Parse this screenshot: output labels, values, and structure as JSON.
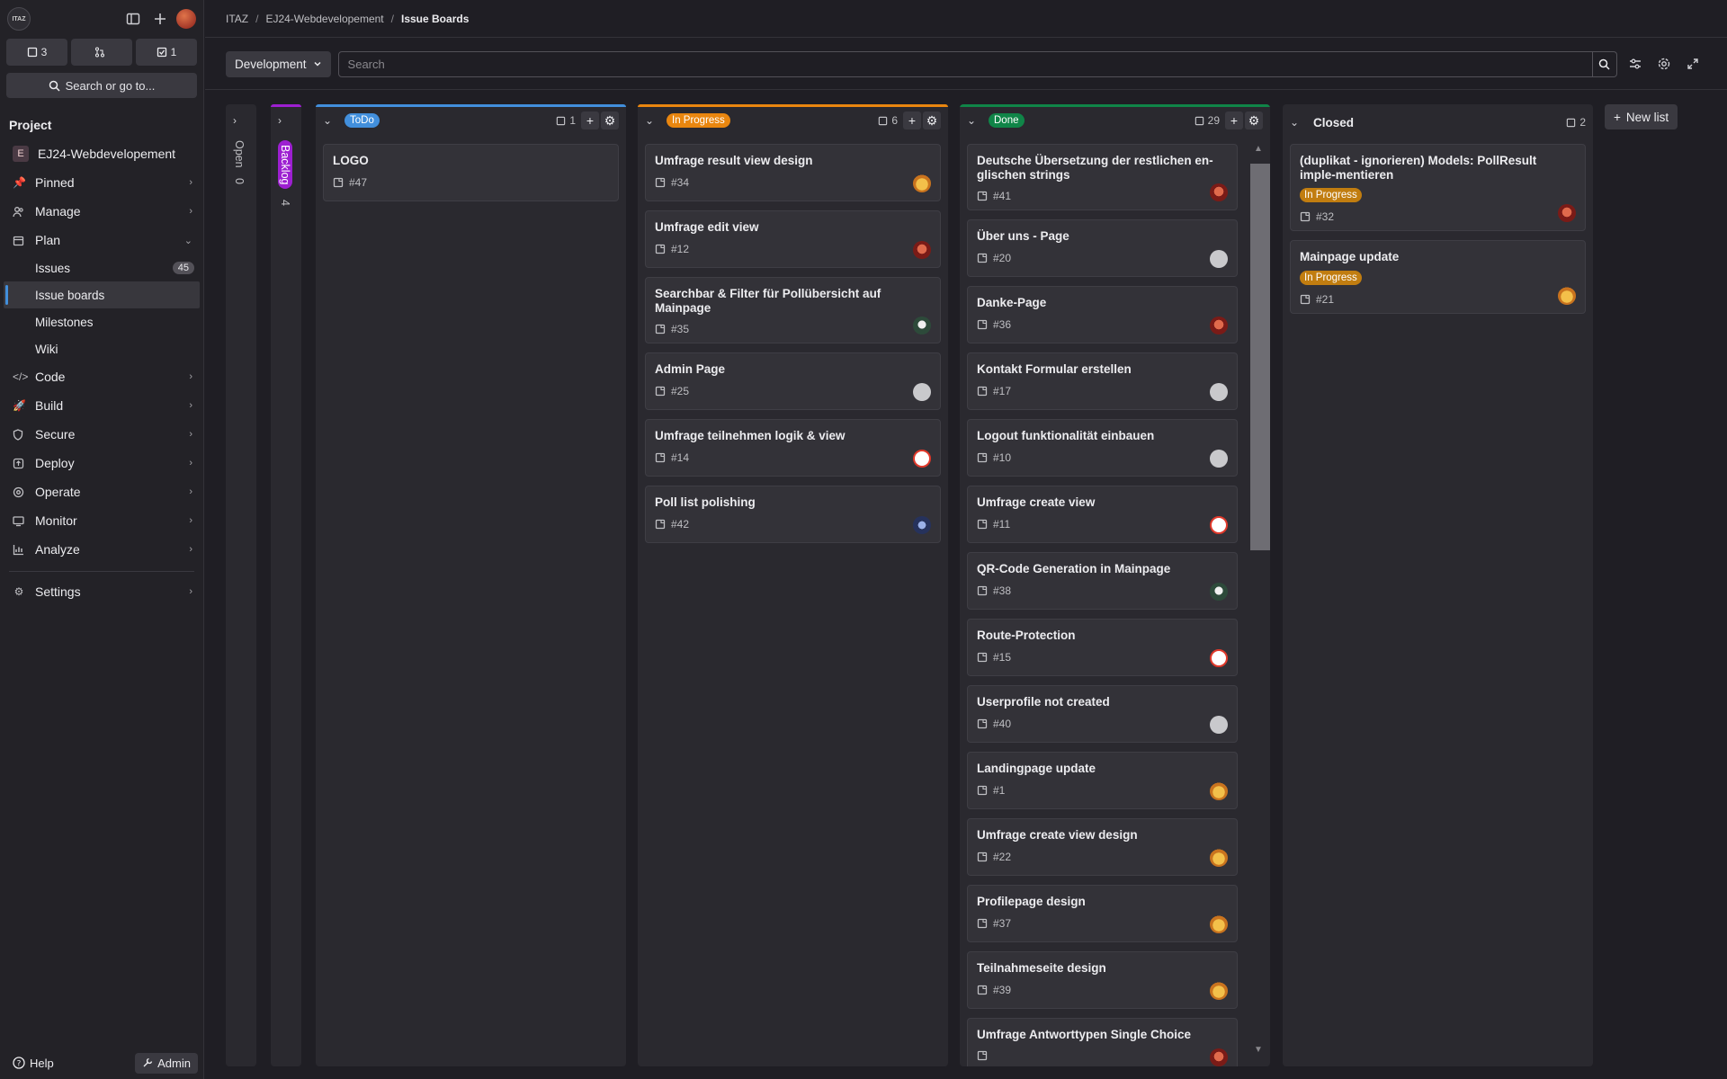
{
  "breadcrumb": [
    "ITAZ",
    "EJ24-Webdevelopement",
    "Issue Boards"
  ],
  "sidebar": {
    "logo_text": "ITAZ",
    "counters": [
      {
        "icon": "issues-icon",
        "value": "3"
      },
      {
        "icon": "merge-request-icon",
        "value": ""
      },
      {
        "icon": "todo-icon",
        "value": "1"
      }
    ],
    "search_label": "Search or go to...",
    "section_title": "Project",
    "project_name": "EJ24-Webdevelopement",
    "project_initial": "E",
    "items_top": [
      {
        "label": "Pinned",
        "icon": "pin-icon"
      },
      {
        "label": "Manage",
        "icon": "users-icon"
      },
      {
        "label": "Plan",
        "icon": "calendar-icon"
      }
    ],
    "plan_sub": [
      {
        "label": "Issues",
        "badge": "45"
      },
      {
        "label": "Issue boards"
      },
      {
        "label": "Milestones"
      },
      {
        "label": "Wiki"
      }
    ],
    "items_bottom": [
      {
        "label": "Code",
        "icon": "code-icon"
      },
      {
        "label": "Build",
        "icon": "rocket-icon"
      },
      {
        "label": "Secure",
        "icon": "shield-icon"
      },
      {
        "label": "Deploy",
        "icon": "deploy-icon"
      },
      {
        "label": "Operate",
        "icon": "operate-icon"
      },
      {
        "label": "Monitor",
        "icon": "monitor-icon"
      },
      {
        "label": "Analyze",
        "icon": "chart-icon"
      }
    ],
    "settings_label": "Settings",
    "help_label": "Help",
    "admin_label": "Admin"
  },
  "filter": {
    "board_name": "Development",
    "search_placeholder": "Search"
  },
  "board": {
    "collapsed": [
      {
        "title": "Open",
        "count": "0"
      },
      {
        "title": "Backlog",
        "count": "4",
        "color": "#9d1fd1"
      }
    ],
    "todo": {
      "label": "ToDo",
      "color": "#428fdc",
      "count": "1",
      "cards": [
        {
          "title": "LOGO",
          "ref": "#47",
          "avatar": ""
        }
      ]
    },
    "progress": {
      "label": "In Progress",
      "color": "#e9860f",
      "count": "6",
      "cards": [
        {
          "title": "Umfrage result view design",
          "ref": "#34",
          "avatar": "fox"
        },
        {
          "title": "Umfrage edit view",
          "ref": "#12",
          "avatar": "red"
        },
        {
          "title": "Searchbar & Filter für Pollübersicht auf Mainpage",
          "ref": "#35",
          "avatar": "dark"
        },
        {
          "title": "Admin Page",
          "ref": "#25",
          "avatar": "grey"
        },
        {
          "title": "Umfrage teilnehmen logik & view",
          "ref": "#14",
          "avatar": "pin"
        },
        {
          "title": "Poll list polishing",
          "ref": "#42",
          "avatar": "blue"
        }
      ]
    },
    "done": {
      "label": "Done",
      "color": "#108548",
      "count": "29",
      "cards": [
        {
          "title": "Deutsche Übersetzung der restlichen en-glischen strings",
          "ref": "#41",
          "avatar": "red"
        },
        {
          "title": "Über uns - Page",
          "ref": "#20",
          "avatar": "grey"
        },
        {
          "title": "Danke-Page",
          "ref": "#36",
          "avatar": "red"
        },
        {
          "title": "Kontakt Formular erstellen",
          "ref": "#17",
          "avatar": "grey"
        },
        {
          "title": "Logout funktionalität einbauen",
          "ref": "#10",
          "avatar": "grey"
        },
        {
          "title": "Umfrage create view",
          "ref": "#11",
          "avatar": "pin"
        },
        {
          "title": "QR-Code Generation in Mainpage",
          "ref": "#38",
          "avatar": "dark"
        },
        {
          "title": "Route-Protection",
          "ref": "#15",
          "avatar": "pin"
        },
        {
          "title": "Userprofile not created",
          "ref": "#40",
          "avatar": "grey"
        },
        {
          "title": "Landingpage update",
          "ref": "#1",
          "avatar": "fox"
        },
        {
          "title": "Umfrage create view design",
          "ref": "#22",
          "avatar": "fox"
        },
        {
          "title": "Profilepage design",
          "ref": "#37",
          "avatar": "fox"
        },
        {
          "title": "Teilnahmeseite design",
          "ref": "#39",
          "avatar": "fox"
        },
        {
          "title": "Umfrage Antworttypen Single Choice",
          "ref": "",
          "avatar": "red"
        }
      ]
    },
    "closed": {
      "title": "Closed",
      "count": "2",
      "cards": [
        {
          "title": "(duplikat - ignorieren) Models: PollResult imple-mentieren",
          "status": "In Progress",
          "ref": "#32",
          "avatar": "red"
        },
        {
          "title": "Mainpage update",
          "status": "In Progress",
          "ref": "#21",
          "avatar": "fox"
        }
      ]
    },
    "new_list_label": "New list"
  }
}
